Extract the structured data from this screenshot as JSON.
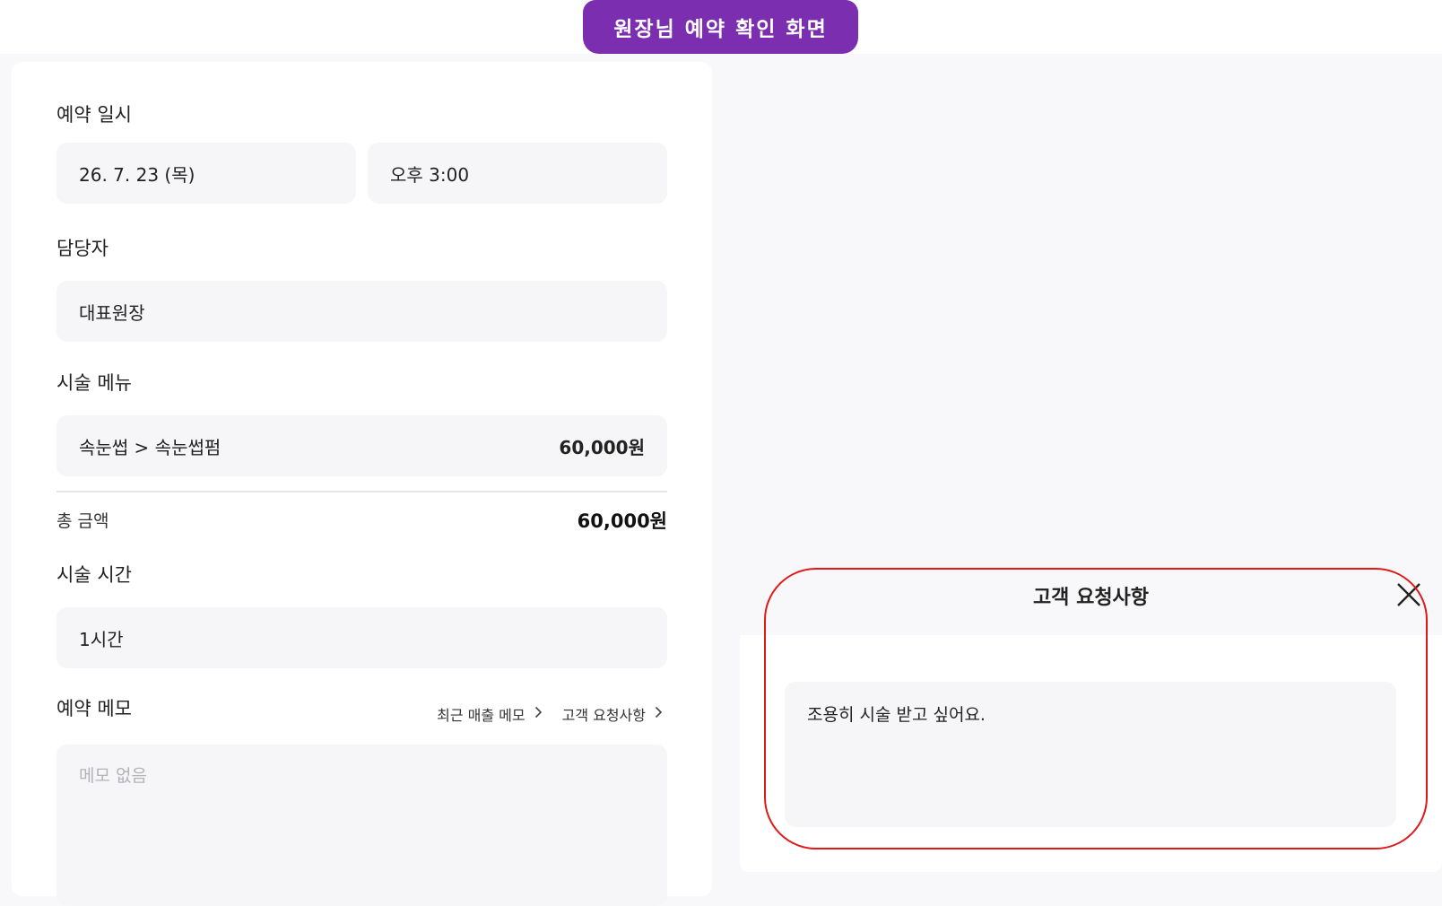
{
  "banner": {
    "title": "원장님 예약 확인 화면"
  },
  "reservation": {
    "datetime_label": "예약 일시",
    "date": "26. 7. 23 (목)",
    "time": "오후 3:00",
    "staff_label": "담당자",
    "staff": "대표원장",
    "menu_label": "시술 메뉴",
    "menu_item": "속눈썹 > 속눈썹펌",
    "menu_price": "60,000원",
    "total_label": "총 금액",
    "total_value": "60,000원",
    "duration_label": "시술 시간",
    "duration": "1시간",
    "memo_label": "예약 메모",
    "memo_links": [
      "최근 매출 메모",
      "고객 요청사항"
    ],
    "memo_placeholder": "메모 없음"
  },
  "request_modal": {
    "title": "고객 요청사항",
    "text": "조용히 시술 받고 싶어요."
  },
  "colors": {
    "banner": "#7b2fb0",
    "highlight": "#e01818",
    "field_bg": "#f6f6f8",
    "page_bg": "#f8f8fa"
  },
  "icons": {
    "close": "close-icon",
    "chevron": "chevron-right-icon"
  }
}
